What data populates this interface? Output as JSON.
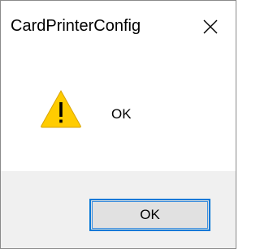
{
  "window": {
    "title": "CardPrinterConfig",
    "close_icon": "close-icon"
  },
  "message": {
    "icon": "warning-icon",
    "text": "OK"
  },
  "buttons": {
    "ok_label": "OK"
  },
  "colors": {
    "footer_background": "#f0f0f0",
    "button_focus_border": "#0078d7",
    "button_background": "#e1e1e1",
    "warning_fill": "#ffcc00"
  }
}
